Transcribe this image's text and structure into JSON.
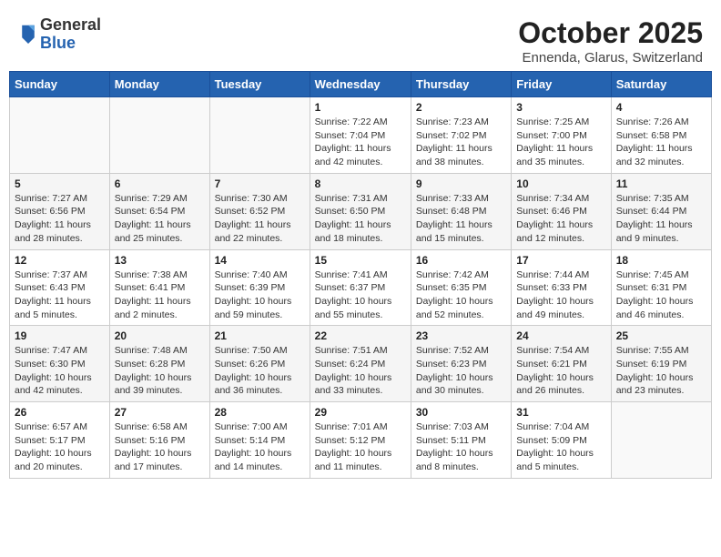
{
  "header": {
    "logo_general": "General",
    "logo_blue": "Blue",
    "title": "October 2025",
    "subtitle": "Ennenda, Glarus, Switzerland"
  },
  "days": [
    "Sunday",
    "Monday",
    "Tuesday",
    "Wednesday",
    "Thursday",
    "Friday",
    "Saturday"
  ],
  "weeks": [
    [
      {
        "date": "",
        "info": ""
      },
      {
        "date": "",
        "info": ""
      },
      {
        "date": "",
        "info": ""
      },
      {
        "date": "1",
        "info": "Sunrise: 7:22 AM\nSunset: 7:04 PM\nDaylight: 11 hours and 42 minutes."
      },
      {
        "date": "2",
        "info": "Sunrise: 7:23 AM\nSunset: 7:02 PM\nDaylight: 11 hours and 38 minutes."
      },
      {
        "date": "3",
        "info": "Sunrise: 7:25 AM\nSunset: 7:00 PM\nDaylight: 11 hours and 35 minutes."
      },
      {
        "date": "4",
        "info": "Sunrise: 7:26 AM\nSunset: 6:58 PM\nDaylight: 11 hours and 32 minutes."
      }
    ],
    [
      {
        "date": "5",
        "info": "Sunrise: 7:27 AM\nSunset: 6:56 PM\nDaylight: 11 hours and 28 minutes."
      },
      {
        "date": "6",
        "info": "Sunrise: 7:29 AM\nSunset: 6:54 PM\nDaylight: 11 hours and 25 minutes."
      },
      {
        "date": "7",
        "info": "Sunrise: 7:30 AM\nSunset: 6:52 PM\nDaylight: 11 hours and 22 minutes."
      },
      {
        "date": "8",
        "info": "Sunrise: 7:31 AM\nSunset: 6:50 PM\nDaylight: 11 hours and 18 minutes."
      },
      {
        "date": "9",
        "info": "Sunrise: 7:33 AM\nSunset: 6:48 PM\nDaylight: 11 hours and 15 minutes."
      },
      {
        "date": "10",
        "info": "Sunrise: 7:34 AM\nSunset: 6:46 PM\nDaylight: 11 hours and 12 minutes."
      },
      {
        "date": "11",
        "info": "Sunrise: 7:35 AM\nSunset: 6:44 PM\nDaylight: 11 hours and 9 minutes."
      }
    ],
    [
      {
        "date": "12",
        "info": "Sunrise: 7:37 AM\nSunset: 6:43 PM\nDaylight: 11 hours and 5 minutes."
      },
      {
        "date": "13",
        "info": "Sunrise: 7:38 AM\nSunset: 6:41 PM\nDaylight: 11 hours and 2 minutes."
      },
      {
        "date": "14",
        "info": "Sunrise: 7:40 AM\nSunset: 6:39 PM\nDaylight: 10 hours and 59 minutes."
      },
      {
        "date": "15",
        "info": "Sunrise: 7:41 AM\nSunset: 6:37 PM\nDaylight: 10 hours and 55 minutes."
      },
      {
        "date": "16",
        "info": "Sunrise: 7:42 AM\nSunset: 6:35 PM\nDaylight: 10 hours and 52 minutes."
      },
      {
        "date": "17",
        "info": "Sunrise: 7:44 AM\nSunset: 6:33 PM\nDaylight: 10 hours and 49 minutes."
      },
      {
        "date": "18",
        "info": "Sunrise: 7:45 AM\nSunset: 6:31 PM\nDaylight: 10 hours and 46 minutes."
      }
    ],
    [
      {
        "date": "19",
        "info": "Sunrise: 7:47 AM\nSunset: 6:30 PM\nDaylight: 10 hours and 42 minutes."
      },
      {
        "date": "20",
        "info": "Sunrise: 7:48 AM\nSunset: 6:28 PM\nDaylight: 10 hours and 39 minutes."
      },
      {
        "date": "21",
        "info": "Sunrise: 7:50 AM\nSunset: 6:26 PM\nDaylight: 10 hours and 36 minutes."
      },
      {
        "date": "22",
        "info": "Sunrise: 7:51 AM\nSunset: 6:24 PM\nDaylight: 10 hours and 33 minutes."
      },
      {
        "date": "23",
        "info": "Sunrise: 7:52 AM\nSunset: 6:23 PM\nDaylight: 10 hours and 30 minutes."
      },
      {
        "date": "24",
        "info": "Sunrise: 7:54 AM\nSunset: 6:21 PM\nDaylight: 10 hours and 26 minutes."
      },
      {
        "date": "25",
        "info": "Sunrise: 7:55 AM\nSunset: 6:19 PM\nDaylight: 10 hours and 23 minutes."
      }
    ],
    [
      {
        "date": "26",
        "info": "Sunrise: 6:57 AM\nSunset: 5:17 PM\nDaylight: 10 hours and 20 minutes."
      },
      {
        "date": "27",
        "info": "Sunrise: 6:58 AM\nSunset: 5:16 PM\nDaylight: 10 hours and 17 minutes."
      },
      {
        "date": "28",
        "info": "Sunrise: 7:00 AM\nSunset: 5:14 PM\nDaylight: 10 hours and 14 minutes."
      },
      {
        "date": "29",
        "info": "Sunrise: 7:01 AM\nSunset: 5:12 PM\nDaylight: 10 hours and 11 minutes."
      },
      {
        "date": "30",
        "info": "Sunrise: 7:03 AM\nSunset: 5:11 PM\nDaylight: 10 hours and 8 minutes."
      },
      {
        "date": "31",
        "info": "Sunrise: 7:04 AM\nSunset: 5:09 PM\nDaylight: 10 hours and 5 minutes."
      },
      {
        "date": "",
        "info": ""
      }
    ]
  ]
}
